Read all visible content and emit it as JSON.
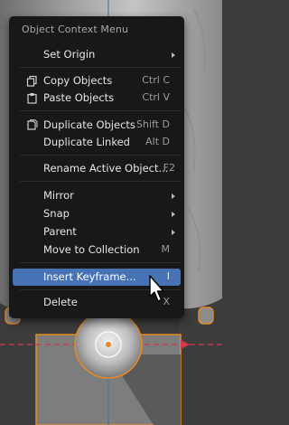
{
  "menu": {
    "title": "Object Context Menu",
    "items": [
      {
        "label": "Set Origin",
        "shortcut": "",
        "submenu": true
      },
      {
        "label": "Copy Objects",
        "shortcut": "Ctrl C",
        "icon": "copy-icon"
      },
      {
        "label": "Paste Objects",
        "shortcut": "Ctrl V",
        "icon": "paste-icon"
      },
      {
        "label": "Duplicate Objects",
        "shortcut": "Shift D",
        "icon": "duplicate-icon"
      },
      {
        "label": "Duplicate Linked",
        "shortcut": "Alt D"
      },
      {
        "label": "Rename Active Object...",
        "shortcut": "F2"
      },
      {
        "label": "Mirror",
        "shortcut": "",
        "submenu": true
      },
      {
        "label": "Snap",
        "shortcut": "",
        "submenu": true
      },
      {
        "label": "Parent",
        "shortcut": "",
        "submenu": true
      },
      {
        "label": "Move to Collection",
        "shortcut": "M"
      },
      {
        "label": "Insert Keyframe...",
        "shortcut": "I",
        "active": true
      },
      {
        "label": "Delete",
        "shortcut": "X"
      }
    ]
  },
  "colors": {
    "menu_bg": "#181818",
    "highlight": "#4772b3",
    "selection_outline": "#e88a25",
    "x_axis": "#d23a4b",
    "viewport_grid": "#3b3b3b"
  }
}
